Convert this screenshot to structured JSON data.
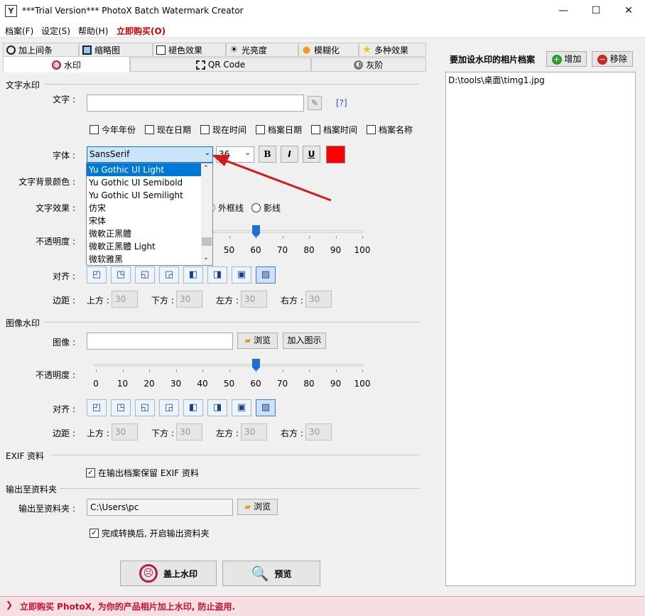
{
  "window": {
    "title": "***Trial Version*** PhotoX Batch Watermark Creator",
    "app_icon_glyph": "Y",
    "minimize_glyph": "—",
    "maximize_glyph": "☐",
    "close_glyph": "✕"
  },
  "menu": {
    "file": "档案(F)",
    "settings": "设定(S)",
    "help": "帮助(H)",
    "buy": "立即购买(O)",
    "buy_color": "#cc0000"
  },
  "tabs_row1": [
    {
      "label": "加上间条",
      "icon": "border-icon"
    },
    {
      "label": "缩略图",
      "icon": "thumbnail-icon"
    },
    {
      "label": "褪色效果",
      "icon": "fade-icon"
    },
    {
      "label": "光亮度",
      "icon": "brightness-icon"
    },
    {
      "label": "模糊化",
      "icon": "blur-icon"
    },
    {
      "label": "多种效果",
      "icon": "star-icon"
    }
  ],
  "tabs_row2": [
    {
      "label": "水印",
      "icon": "watermark-icon"
    },
    {
      "label": "QR Code",
      "icon": "qrcode-icon"
    },
    {
      "label": "灰阶",
      "icon": "grayscale-icon"
    }
  ],
  "text_watermark": {
    "section": "文字水印",
    "text_label": "文字 :",
    "help_link": "[?]",
    "options": [
      "今年年份",
      "现在日期",
      "现在时间",
      "档案日期",
      "档案时间",
      "档案名称"
    ],
    "font_label": "字体 :",
    "font_value": "SansSerif",
    "size_value": "36",
    "bold": "B",
    "italic": "I",
    "underline": "U",
    "text_color": "#ff0000",
    "bg_color_label": "文字背景颜色 :",
    "effect_label": "文字效果 :",
    "effect_outline": "外框线",
    "effect_shadow": "影线",
    "opacity_label": "不透明度 :",
    "opacity_value": 60,
    "align_label": "对齐 :",
    "margin_label": "边距 :",
    "margin_top_label": "上方 :",
    "margin_bottom_label": "下方 :",
    "margin_left_label": "左方 :",
    "margin_right_label": "右方 :",
    "margin_top": "30",
    "margin_bottom": "30",
    "margin_left": "30",
    "margin_right": "30"
  },
  "font_dropdown": [
    "Yu Gothic UI Light",
    "Yu Gothic UI Semibold",
    "Yu Gothic UI Semilight",
    "仿宋",
    "宋体",
    "微軟正黑體",
    "微軟正黑體 Light",
    "微软雅黑"
  ],
  "visible_ticks": [
    "50",
    "60",
    "70",
    "80",
    "90",
    "100"
  ],
  "ticks": [
    "0",
    "10",
    "20",
    "30",
    "40",
    "50",
    "60",
    "70",
    "80",
    "90",
    "100"
  ],
  "image_watermark": {
    "section": "图像水印",
    "image_label": "图像 :",
    "browse": "浏览",
    "add_icon": "加入图示",
    "opacity_label": "不透明度 :",
    "opacity_value": 60,
    "align_label": "对齐 :",
    "margin_label": "边距 :",
    "margin_top_label": "上方 :",
    "margin_bottom_label": "下方 :",
    "margin_left_label": "左方 :",
    "margin_right_label": "右方 :",
    "margin_top": "30",
    "margin_bottom": "30",
    "margin_left": "30",
    "margin_right": "30"
  },
  "exif": {
    "section": "EXIF 资料",
    "keep_label": "在输出档案保留 EXIF 资料"
  },
  "output": {
    "section": "输出至资料夹",
    "folder_label": "输出至资料夹 :",
    "folder_value": "C:\\Users\\pc",
    "browse": "浏览",
    "open_after": "完成转换后, 开启输出资料夹"
  },
  "actions": {
    "apply": "盖上水印",
    "preview": "预览"
  },
  "files": {
    "header": "要加设水印的相片档案",
    "add": "增加",
    "remove": "移除",
    "items": [
      "D:\\tools\\桌面\\timg1.jpg"
    ]
  },
  "footer": {
    "arrow": "❯",
    "message": "立即购买 PhotoX, 为你的产品相片加上水印, 防止盗用."
  }
}
